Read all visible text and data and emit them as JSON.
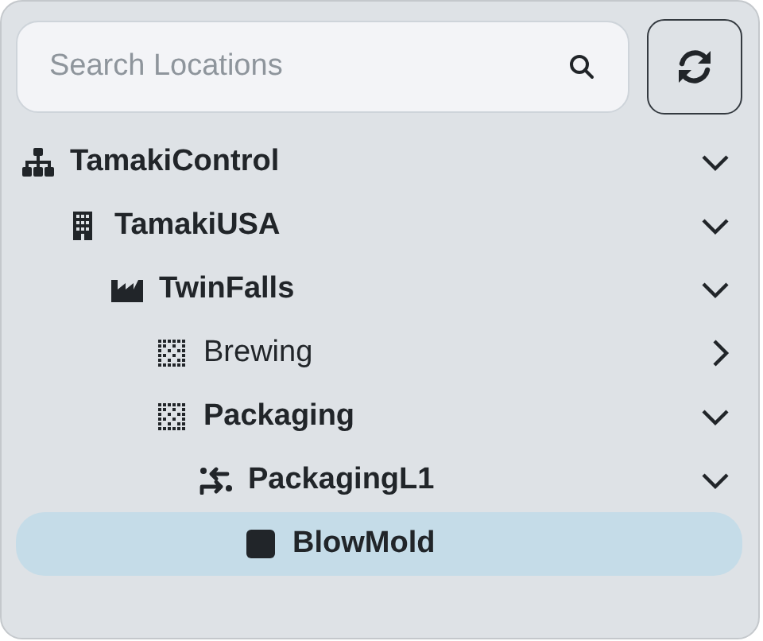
{
  "search": {
    "placeholder": "Search Locations"
  },
  "tree": [
    {
      "label": "TamakiControl",
      "kind": "enterprise",
      "expanded": true,
      "selected": false,
      "children": [
        {
          "label": "TamakiUSA",
          "kind": "site",
          "expanded": true,
          "selected": false,
          "children": [
            {
              "label": "TwinFalls",
              "kind": "area",
              "expanded": true,
              "selected": false,
              "children": [
                {
                  "label": "Brewing",
                  "kind": "cell",
                  "expanded": false,
                  "selected": false
                },
                {
                  "label": "Packaging",
                  "kind": "cell",
                  "expanded": true,
                  "selected": false,
                  "children": [
                    {
                      "label": "PackagingL1",
                      "kind": "line",
                      "expanded": true,
                      "selected": false,
                      "children": [
                        {
                          "label": "BlowMold",
                          "kind": "unit",
                          "selected": true
                        }
                      ]
                    }
                  ]
                }
              ]
            }
          ]
        }
      ]
    }
  ]
}
